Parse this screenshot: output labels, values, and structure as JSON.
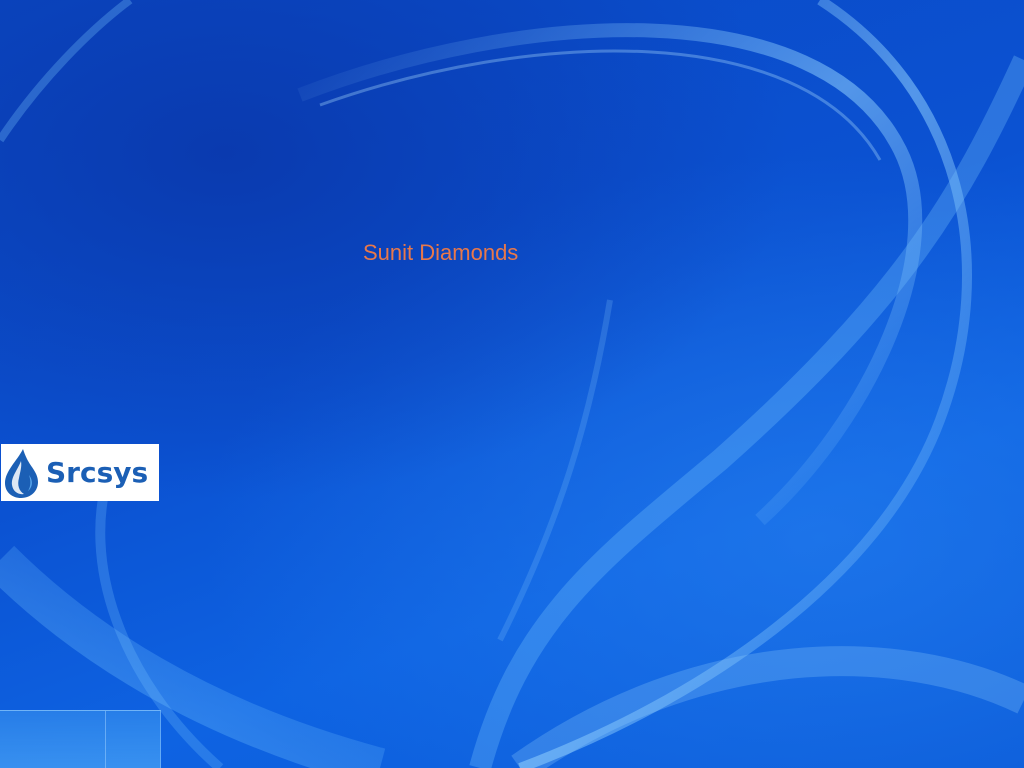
{
  "desktop": {
    "center_label": "Sunit Diamonds",
    "center_label_color": "#e8784a",
    "background_color": "#0b52d2",
    "logo": {
      "text": "Srcsys",
      "icon": "water-drop-icon",
      "text_color": "#1b5fb5",
      "background_color": "#ffffff"
    }
  }
}
